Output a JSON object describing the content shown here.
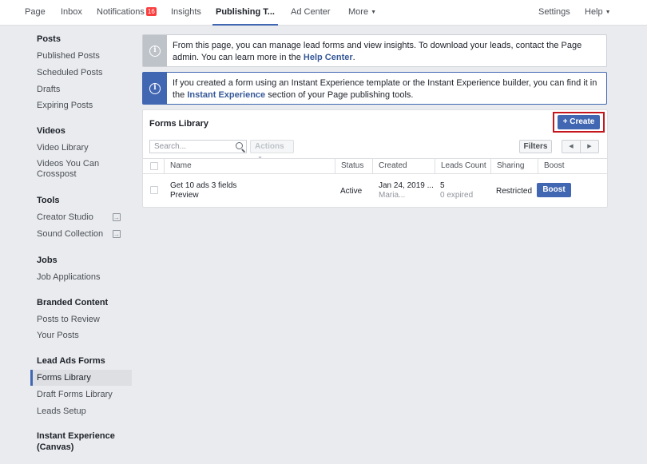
{
  "topnav": {
    "page": "Page",
    "inbox": "Inbox",
    "notifications": "Notifications",
    "notifications_count": "16",
    "insights": "Insights",
    "publishing_tools": "Publishing T...",
    "ad_center": "Ad Center",
    "more": "More",
    "settings": "Settings",
    "help": "Help"
  },
  "sidebar": {
    "posts": {
      "heading": "Posts",
      "items": [
        "Published Posts",
        "Scheduled Posts",
        "Drafts",
        "Expiring Posts"
      ]
    },
    "videos": {
      "heading": "Videos",
      "items": [
        "Video Library",
        "Videos You Can Crosspost"
      ]
    },
    "tools": {
      "heading": "Tools",
      "items": [
        "Creator Studio",
        "Sound Collection"
      ]
    },
    "jobs": {
      "heading": "Jobs",
      "items": [
        "Job Applications"
      ]
    },
    "branded": {
      "heading": "Branded Content",
      "items": [
        "Posts to Review",
        "Your Posts"
      ]
    },
    "lead_ads": {
      "heading": "Lead Ads Forms",
      "items": [
        "Forms Library",
        "Draft Forms Library",
        "Leads Setup"
      ]
    },
    "instant": {
      "heading": "Instant Experience (Canvas)"
    }
  },
  "notices": {
    "first": {
      "text": "From this page, you can manage lead forms and view insights. To download your leads, contact the Page admin. You can learn more in the ",
      "link": "Help Center",
      "end": "."
    },
    "second": {
      "text": "If you created a form using an Instant Experience template or the Instant Experience builder, you can find it in the ",
      "link": "Instant Experience",
      "end": " section of your Page publishing tools."
    }
  },
  "forms_library": {
    "title": "Forms Library",
    "create_label": "+ Create",
    "search_placeholder": "Search...",
    "actions_label": "Actions",
    "filters_label": "Filters",
    "columns": [
      "Name",
      "Status",
      "Created",
      "Leads Count",
      "Sharing",
      "Boost"
    ],
    "rows": [
      {
        "name": "Get 10 ads 3 fields",
        "preview": "Preview",
        "status": "Active",
        "created": "Jan 24, 2019 ...",
        "created_by": "Maria...",
        "leads": "5",
        "expired": "0 expired",
        "sharing": "Restricted",
        "boost": "Boost"
      }
    ]
  },
  "colors": {
    "accent": "#4267b2",
    "highlight": "#c4161c",
    "badge": "#fa3e3e",
    "notice_gray": "#bec3c9",
    "notice_blue": "#4267b2"
  }
}
